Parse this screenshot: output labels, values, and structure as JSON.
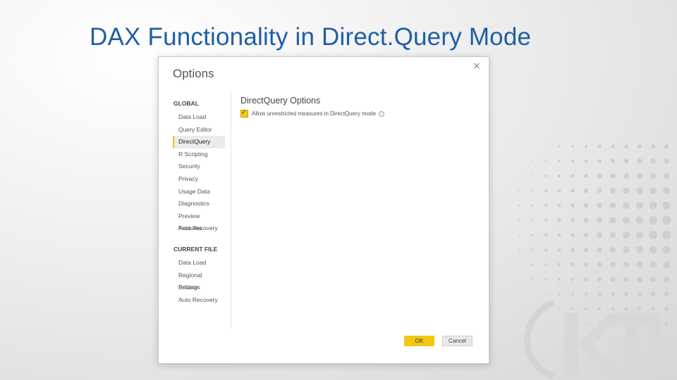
{
  "slide": {
    "title": "DAX Functionality in Direct.Query Mode"
  },
  "dialog": {
    "title": "Options",
    "close_icon": "×",
    "global_heading": "GLOBAL",
    "global_items": [
      {
        "label": "Data Load"
      },
      {
        "label": "Query Editor"
      },
      {
        "label": "DirectQuery",
        "active": true
      },
      {
        "label": "R Scripting"
      },
      {
        "label": "Security"
      },
      {
        "label": "Privacy"
      },
      {
        "label": "Usage Data"
      },
      {
        "label": "Diagnostics"
      },
      {
        "label": "Preview Features"
      },
      {
        "label": "Auto Recovery"
      }
    ],
    "current_heading": "CURRENT FILE",
    "current_items": [
      {
        "label": "Data Load"
      },
      {
        "label": "Regional Settings"
      },
      {
        "label": "Privacy"
      },
      {
        "label": "Auto Recovery"
      }
    ],
    "content_title": "DirectQuery Options",
    "checkbox": {
      "label": "Allow unrestricted measures in DirectQuery mode",
      "checked": true,
      "info_icon": "info-icon"
    },
    "ok_label": "OK",
    "cancel_label": "Cancel"
  },
  "colors": {
    "accent": "#f2c811",
    "title": "#1f5fa6"
  }
}
